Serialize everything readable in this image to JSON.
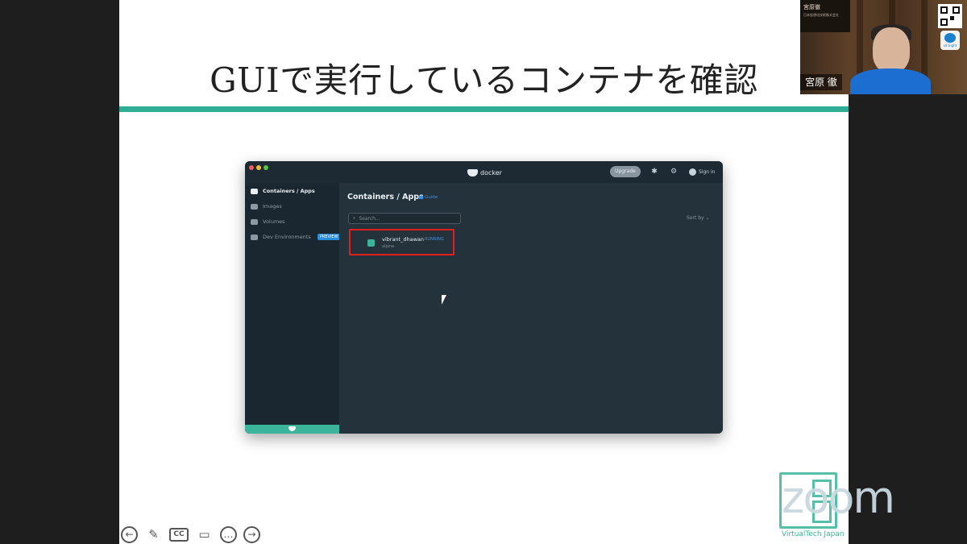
{
  "slide": {
    "title": "GUIで実行しているコンテナを確認"
  },
  "docker_window": {
    "app_name": "docker",
    "toolbar": {
      "upgrade_label": "Upgrade",
      "signin_label": "Sign in"
    },
    "sidebar": {
      "items": [
        {
          "label": "Containers / Apps",
          "icon": "container-icon"
        },
        {
          "label": "Images",
          "icon": "images-icon"
        },
        {
          "label": "Volumes",
          "icon": "volumes-icon"
        },
        {
          "label": "Dev Environments",
          "icon": "dev-env-icon",
          "badge": "PREVIEW"
        }
      ]
    },
    "main": {
      "title": "Containers / Apps",
      "guide_label": "Guide",
      "search_placeholder": "Search...",
      "sort_label": "Sort by",
      "containers": [
        {
          "name": "vibrant_dhawan",
          "status": "RUNNING",
          "sub": "alpine"
        }
      ]
    }
  },
  "meeting": {
    "speaker_name": "宮原 徹",
    "poster_title": "宮原徹",
    "poster_sub": "日本仮想化技術株式会社",
    "badge_label": "v8 Eight",
    "zoom_label": "zoom",
    "vt_label": "VirtualTech Japan"
  },
  "controls": [
    {
      "name": "prev-slide-icon",
      "glyph": "←"
    },
    {
      "name": "pen-icon",
      "glyph": "✎"
    },
    {
      "name": "cc-icon",
      "glyph": "CC"
    },
    {
      "name": "video-off-icon",
      "glyph": "▭"
    },
    {
      "name": "more-icon",
      "glyph": "…"
    },
    {
      "name": "next-slide-icon",
      "glyph": "→"
    }
  ],
  "colors": {
    "accent": "#2fae95",
    "docker_bg": "#24323c",
    "highlight": "#e21e1e"
  }
}
